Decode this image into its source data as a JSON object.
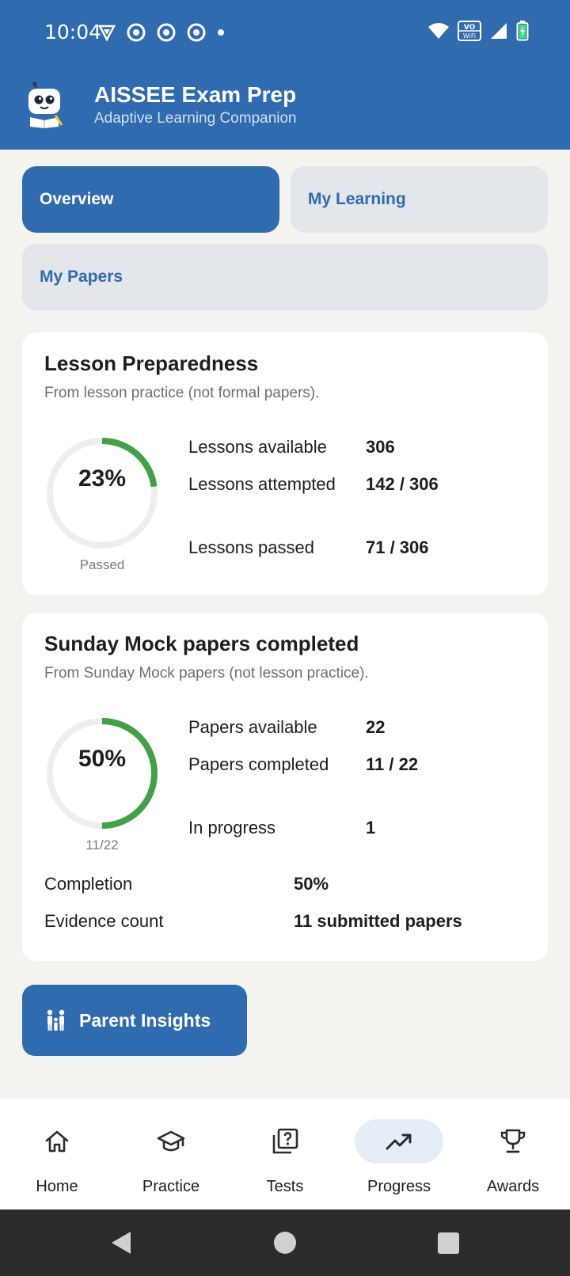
{
  "status_bar": {
    "time": "10:04",
    "wifi_badge_top": "VO",
    "wifi_badge_bottom": "WiFi"
  },
  "app": {
    "title": "AISSEE Exam Prep",
    "subtitle": "Adaptive Learning Companion"
  },
  "tabs": [
    {
      "label": "Overview",
      "active": true
    },
    {
      "label": "My Learning",
      "active": false
    },
    {
      "label": "My Papers",
      "active": false
    }
  ],
  "lesson_card": {
    "title": "Lesson Preparedness",
    "subtitle": "From lesson practice (not formal papers).",
    "ring": {
      "percent_text": "23%",
      "caption": "Passed",
      "fraction": 0.23
    },
    "stats": [
      {
        "label": "Lessons available",
        "value": "306"
      },
      {
        "label": "Lessons attempted",
        "value": "142 / 306"
      },
      {
        "label": "Lessons passed",
        "value": "71 / 306"
      }
    ]
  },
  "mock_card": {
    "title": "Sunday Mock papers completed",
    "subtitle": "From Sunday Mock papers (not lesson practice).",
    "ring": {
      "percent_text": "50%",
      "caption": "11/22",
      "fraction": 0.5
    },
    "stats": [
      {
        "label": "Papers available",
        "value": "22"
      },
      {
        "label": "Papers completed",
        "value": "11 / 22"
      },
      {
        "label": "In progress",
        "value": "1"
      }
    ],
    "rows": [
      {
        "label": "Completion",
        "value": "50%"
      },
      {
        "label": "Evidence count",
        "value": "11 submitted papers"
      }
    ]
  },
  "parent_insights": {
    "label": "Parent Insights",
    "icon": "family-icon"
  },
  "bottom_nav": [
    {
      "label": "Home",
      "icon": "home-icon",
      "active": false
    },
    {
      "label": "Practice",
      "icon": "graduation-cap-icon",
      "active": false
    },
    {
      "label": "Tests",
      "icon": "quiz-icon",
      "active": false
    },
    {
      "label": "Progress",
      "icon": "trending-up-icon",
      "active": true
    },
    {
      "label": "Awards",
      "icon": "trophy-icon",
      "active": false
    }
  ],
  "colors": {
    "primary": "#2F6BAE",
    "ring_green": "#43A047",
    "ring_track": "#EEEEEE",
    "nav_active_pill": "#E5EEF7"
  }
}
